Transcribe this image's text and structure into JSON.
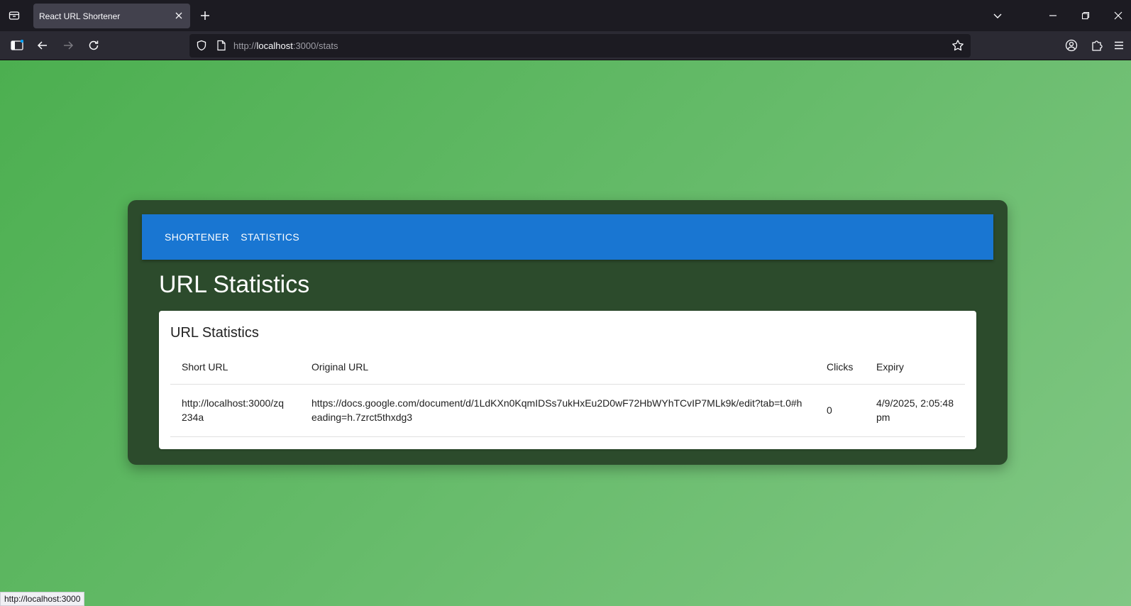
{
  "browser": {
    "tab_title": "React URL Shortener",
    "url_prefix": "http://",
    "url_host": "localhost",
    "url_rest": ":3000/stats",
    "status_url": "http://localhost:3000"
  },
  "appbar": {
    "items": [
      "SHORTENER",
      "STATISTICS"
    ]
  },
  "page": {
    "title": "URL Statistics",
    "card_title": "URL Statistics"
  },
  "table": {
    "headers": [
      "Short URL",
      "Original URL",
      "Clicks",
      "Expiry"
    ],
    "rows": [
      {
        "short_url": "http://localhost:3000/zq234a",
        "original_url": "https://docs.google.com/document/d/1LdKXn0KqmIDSs7ukHxEu2D0wF72HbWYhTCvIP7MLk9k/edit?tab=t.0#heading=h.7zrct5thxdg3",
        "clicks": "0",
        "expiry": "4/9/2025, 2:05:48 pm"
      }
    ]
  },
  "colors": {
    "appbar": "#1976d2",
    "card": "#2c4b2c",
    "background_start": "#4caf50",
    "background_end": "#81c784"
  }
}
